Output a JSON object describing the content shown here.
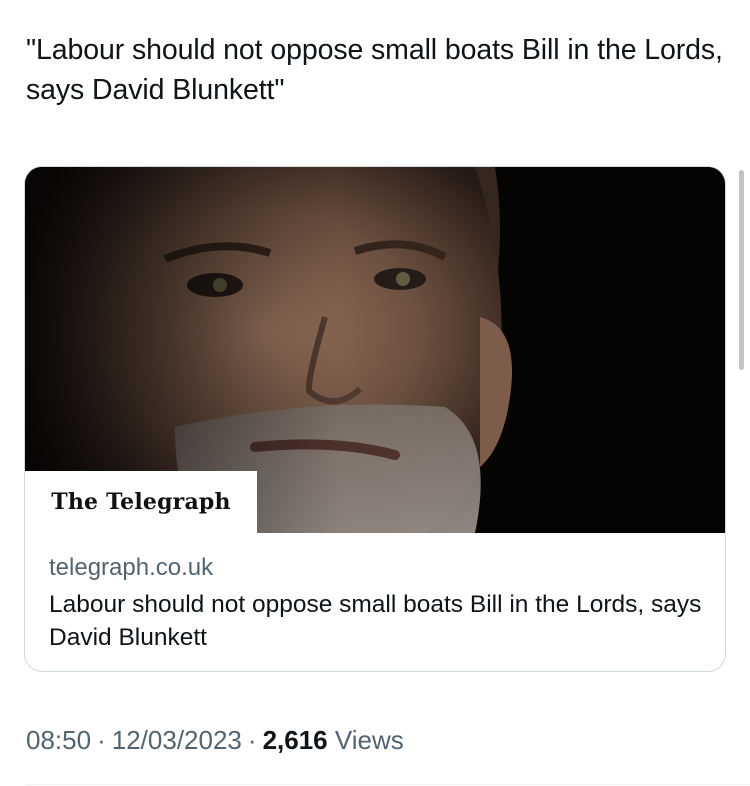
{
  "tweet": {
    "text": "\"Labour should not oppose small boats Bill in the Lords, says David Blunkett\""
  },
  "card": {
    "image_description_icon": "portrait-photo",
    "publisher_logo": "The Telegraph",
    "domain": "telegraph.co.uk",
    "title": "Labour should not oppose small boats Bill in the Lords, says David Blunkett"
  },
  "meta": {
    "time": "08:50",
    "separator": "·",
    "date": "12/03/2023",
    "views_count": "2,616",
    "views_label": "Views"
  }
}
